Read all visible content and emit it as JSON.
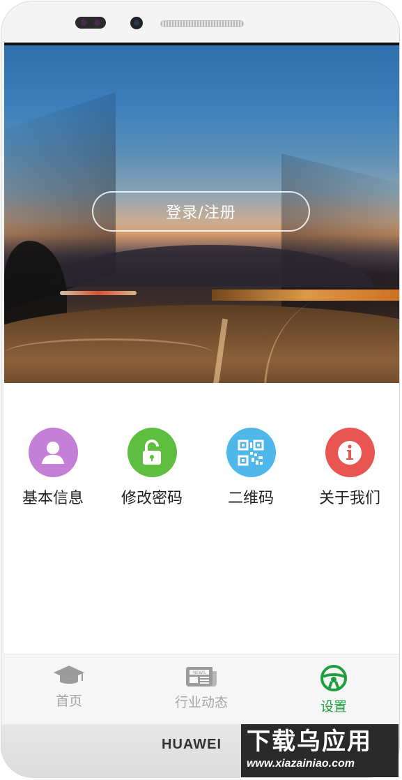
{
  "hero": {
    "login_label": "登录/注册"
  },
  "menu": {
    "items": [
      {
        "label": "基本信息",
        "icon": "user-icon",
        "color": "#c47fd6"
      },
      {
        "label": "修改密码",
        "icon": "unlock-icon",
        "color": "#5ebe3f"
      },
      {
        "label": "二维码",
        "icon": "qr-code-icon",
        "color": "#4fb7ea"
      },
      {
        "label": "关于我们",
        "icon": "info-icon",
        "color": "#e95550"
      }
    ]
  },
  "tabbar": {
    "items": [
      {
        "label": "首页",
        "icon": "graduation-cap-icon",
        "active": false
      },
      {
        "label": "行业动态",
        "icon": "newspaper-icon",
        "active": false
      },
      {
        "label": "设置",
        "icon": "steering-wheel-icon",
        "active": true
      }
    ],
    "active_color": "#1f9e3d",
    "inactive_color": "#a4a4a4"
  },
  "device": {
    "brand": "HUAWEI"
  },
  "watermark": {
    "title": "下载乌应用",
    "url": "www.xiazainiao.com"
  }
}
